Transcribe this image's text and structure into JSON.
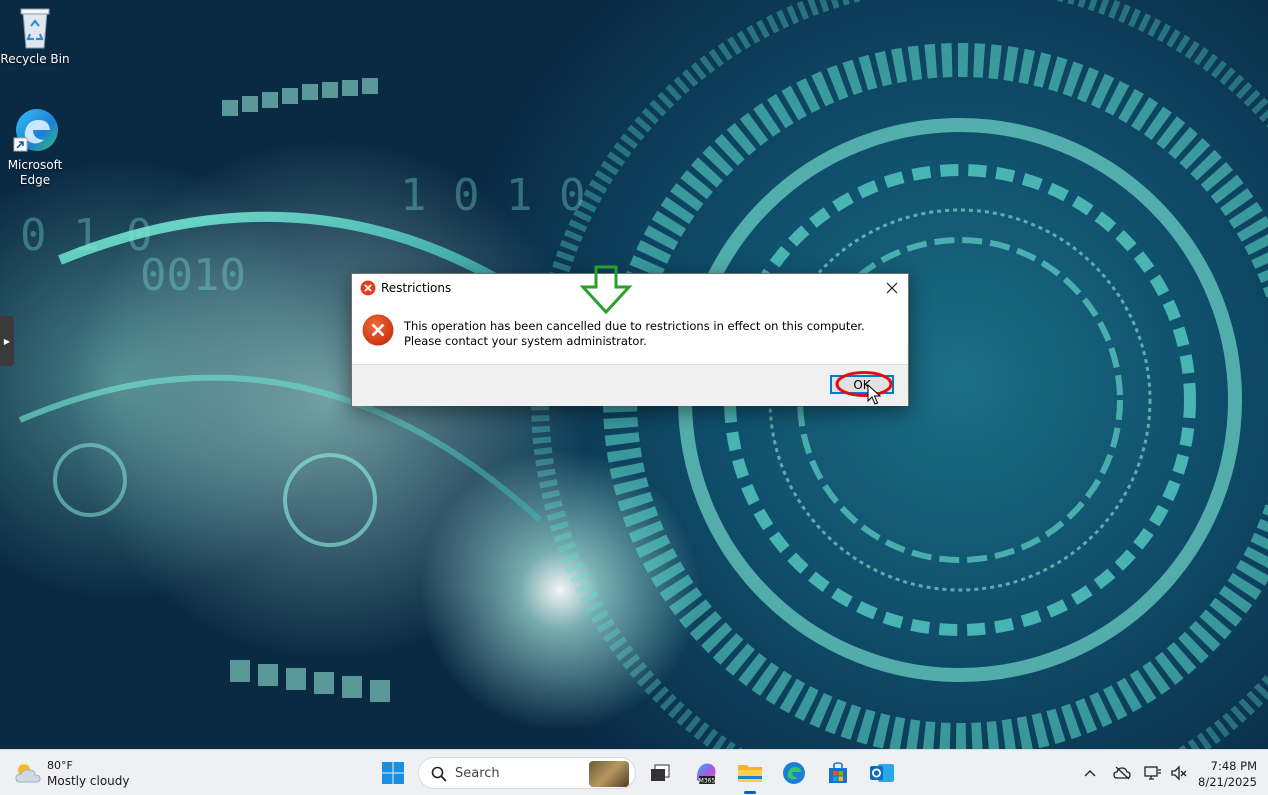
{
  "desktop": {
    "icons": [
      {
        "label": "Recycle Bin",
        "icon": "recycle-bin-icon"
      },
      {
        "label": "Microsoft Edge",
        "icon": "edge-icon"
      }
    ]
  },
  "dialog": {
    "title": "Restrictions",
    "message": "This operation has been cancelled due to restrictions in effect on this computer. Please contact your system administrator.",
    "ok_label": "OK",
    "close_icon": "close-icon",
    "error_icon": "error-icon"
  },
  "taskbar": {
    "weather": {
      "temp": "80°F",
      "condition": "Mostly cloudy"
    },
    "search_placeholder": "Search",
    "pinned": [
      "start",
      "search",
      "task-view",
      "m365-copilot",
      "file-explorer",
      "edge",
      "microsoft-store",
      "outlook"
    ],
    "clock": {
      "time": "7:48 PM",
      "date": "8/21/2025"
    }
  },
  "colors": {
    "accent": "#0078d7",
    "error_red": "#e0401c",
    "annotation_red": "#e01010",
    "annotation_green": "#2aa02a",
    "taskbar_bg": "#eef0f4"
  }
}
